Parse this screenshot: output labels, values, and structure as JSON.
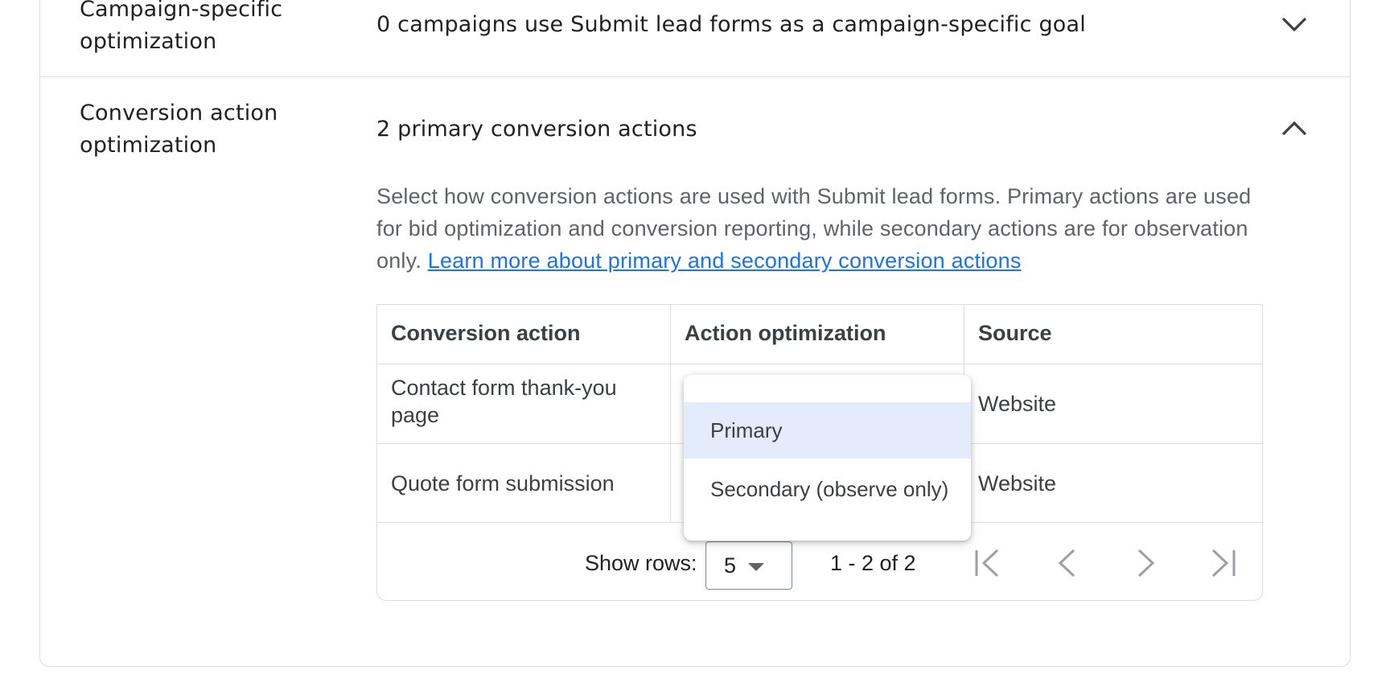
{
  "sections": {
    "campaign": {
      "label_line1": "Campaign-specific",
      "label_line2": "optimization",
      "summary": "0 campaigns use Submit lead forms as a campaign-specific goal",
      "chevron_icon": "chevron-down-icon"
    },
    "conversion": {
      "label_line1": "Conversion action",
      "label_line2": "optimization",
      "summary": "2 primary conversion actions",
      "chevron_icon": "chevron-up-icon",
      "description": "Select how conversion actions are used with Submit lead forms. Primary actions are used for bid optimization and conversion reporting, while secondary actions are for observation only.",
      "learn_more_link": "Learn more about primary and secondary conversion actions"
    }
  },
  "table": {
    "columns": [
      "Conversion action",
      "Action optimization",
      "Source"
    ],
    "rows": [
      {
        "action_line1": "Contact form thank-you",
        "action_line2": "page",
        "source": "Website"
      },
      {
        "action_line1": "Quote form submission",
        "action_line2": "",
        "source": "Website"
      }
    ],
    "footer": {
      "show_rows_label": "Show rows:",
      "rows_value": "5",
      "range_text": "1 - 2 of 2"
    }
  },
  "dropdown_menu": {
    "options": [
      "Primary",
      "Secondary (observe only)"
    ],
    "highlighted": "Primary"
  },
  "colors": {
    "link": "#1a73e8",
    "border": "#dadce0",
    "menu_highlight": "#e4ecfc"
  }
}
